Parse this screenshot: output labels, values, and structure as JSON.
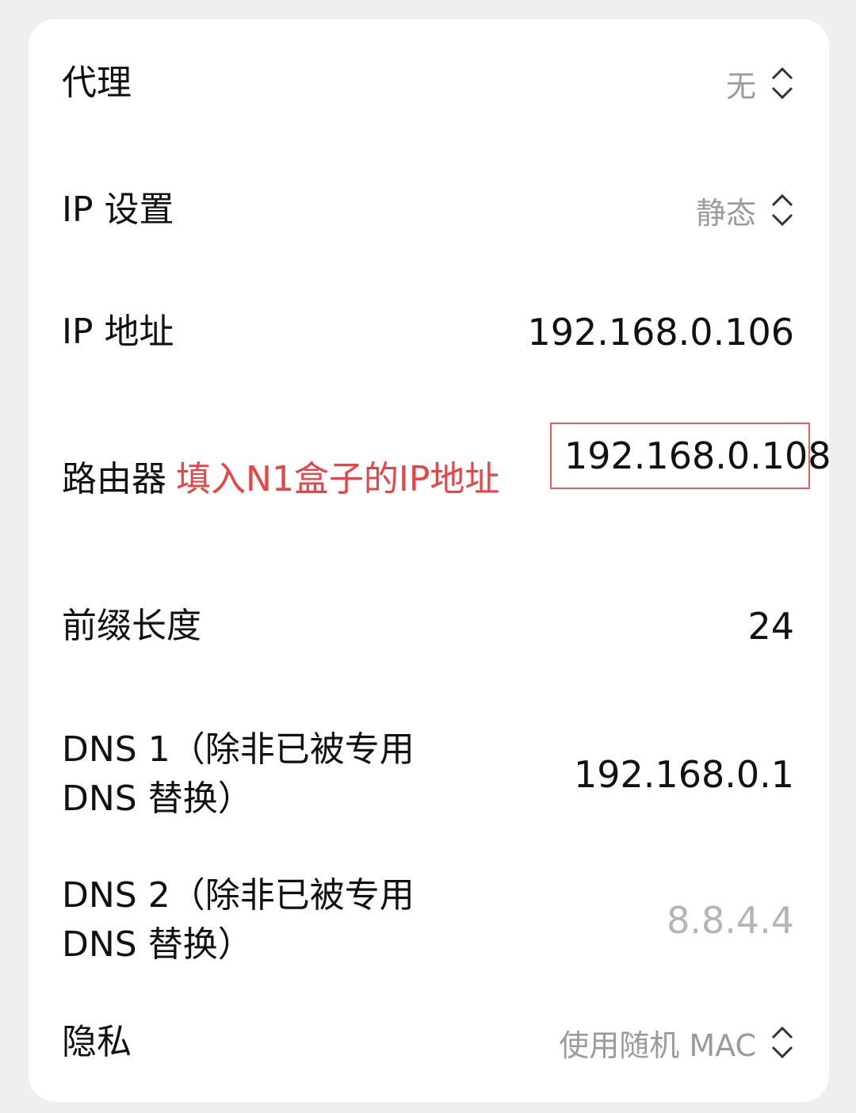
{
  "rows": {
    "proxy": {
      "label": "代理",
      "value": "无",
      "icon": "up-down-chevron-icon"
    },
    "ip_settings": {
      "label": "IP 设置",
      "value": "静态",
      "icon": "up-down-chevron-icon"
    },
    "ip_address": {
      "label": "IP 地址",
      "value": "192.168.0.106"
    },
    "router": {
      "label": "路由器",
      "annotation": "填入N1盒子的IP地址",
      "value": "192.168.0.108"
    },
    "prefix_length": {
      "label": "前缀长度",
      "value": "24"
    },
    "dns1": {
      "label": "DNS 1（除非已被专用 DNS 替换）",
      "value": "192.168.0.1"
    },
    "dns2": {
      "label": "DNS 2（除非已被专用 DNS 替换）",
      "placeholder": "8.8.4.4"
    },
    "privacy": {
      "label": "隐私",
      "value": "使用随机 MAC",
      "icon": "up-down-chevron-icon"
    }
  },
  "colors": {
    "annotation": "#e64545",
    "highlight_box": "#e06161",
    "cursor": "#2a6bd8"
  }
}
